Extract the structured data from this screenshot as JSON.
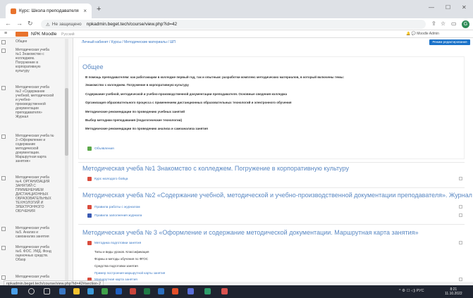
{
  "browser": {
    "tab_title": "Курс: Школа преподавателя",
    "tab_close": "×",
    "new_tab": "+",
    "win_min": "—",
    "win_max": "☐",
    "win_close": "✕",
    "not_secure": "Не защищено",
    "url": "npkadmin.beget.tech/course/view.php?id=42",
    "status_url": "npkadmin.beget.tech/course/view.php?id=42#section-2",
    "profile_initial": "G"
  },
  "moodle": {
    "site_name": "NPK Moodle",
    "language": "Русский",
    "user_name": "Moodle Admin"
  },
  "breadcrumb": "Личный кабинет / Курсы / Методические материалы / ШП",
  "edit_button": "Режим редактирования",
  "sidebar": {
    "items": [
      "Общее",
      "Методическая учеба №1 Знакомство с колледжем. Погружение в корпоративную культуру",
      "Методическая учеба №2 «Содержание учебной, методической и учебно-производственной документации преподавателя» Журнал",
      "Методическая учеба № 3 «Оформление и содержание методической документации. Маршрутная карта занятия»",
      "Методическая учеба №4. ОРГАНИЗАЦИЯ ЗАНЯТИЙ С ПРИМЕНЕНИЕМ ДИСТАНЦИОННЫХ ОБРАЗОВАТЕЛЬНЫХ ТЕХНОЛОГИЙ И ЭЛЕКТРОННОГО ОБУЧЕНИЯ",
      "Методическая учеба №5. Анализ и самоанализ занятия",
      "Методическая учеба №6. ФОС. УМД. Фонд оценочных средств. Обзор",
      "Методическая учеба"
    ]
  },
  "general": {
    "title": "Общее",
    "lines": [
      "В помощь преподавателям: как работающим в колледже первый год, так и опытным: разработки комплекс методических материалов, в который включены темы:",
      "Знакомство с колледжем. Погружение в корпоративную культуру",
      "Содержание учебной, методической и учебно-производственной документации преподавателя. Основные сведения колледжа",
      "Организация образовательного процесса с применением дистанционных образовательных технологий и электронного обучения",
      "Методические рекомендации по проведению учебных занятий",
      "Выбор методики преподавания (педагогические технологии)",
      "Методические рекомендации по проведению анализа и самоанализа занятия"
    ],
    "forum": "Объявления"
  },
  "sections": [
    {
      "title": "Методическая учеба №1 Знакомство с колледжем. Погружение в корпоративную культуру",
      "activities": [
        "Курс молодого бойца"
      ]
    },
    {
      "title": "Методическая учеба №2 «Содержание учебной, методической и учебно-производственной документации преподавателя». Журнал",
      "activities": [
        "Правила работы с журналом",
        "Правила заполнения журнала"
      ]
    },
    {
      "title": "Методическая учеба № 3 «Оформление и содержание методической документации. Маршрутная карта занятия»",
      "activities": [
        "Методика подготовки занятия"
      ],
      "notes": [
        "Типы и виды уроков. Классификация",
        "Формы и методы обучения по ФГОС",
        "Средства подготовки занятия",
        "Пример построения маршрутной карты занятия"
      ],
      "last_activity": "Маршрутная карта занятия"
    }
  ],
  "taskbar": {
    "tray": "^ ⚙ ☐ ◁) РУС",
    "time": "8:21",
    "date": "11.10.2022"
  },
  "colors": {
    "accent": "#1a72c9",
    "section_title": "#5a88c3",
    "link": "#3a78c5",
    "moodle_orange": "#e8732d"
  }
}
